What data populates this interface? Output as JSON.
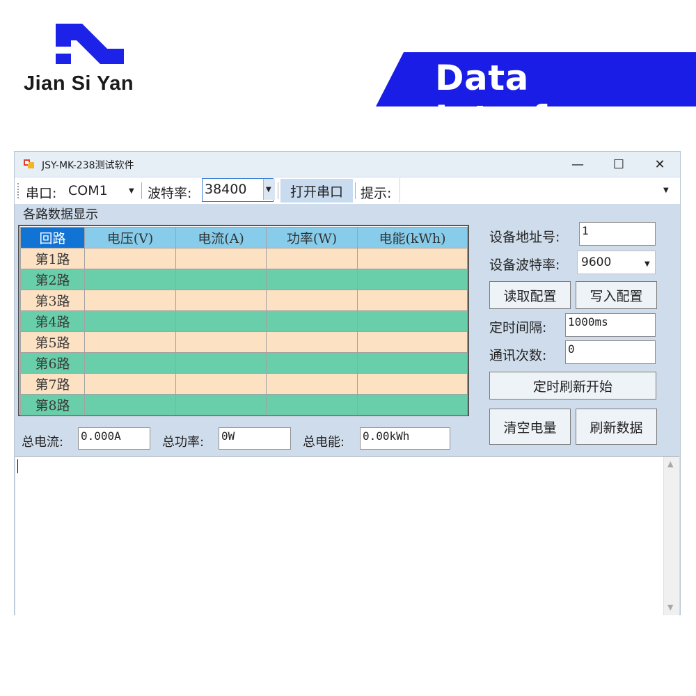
{
  "brand": {
    "name": "Jian Si Yan",
    "banner": "Data Interface",
    "colors": {
      "blue": "#1d22e8",
      "banner_blue": "#1a1de6"
    }
  },
  "window": {
    "title": "JSY-MK-238测试软件",
    "controls": {
      "minimize": "—",
      "maximize": "☐",
      "close": "✕"
    }
  },
  "toolbar": {
    "port_label": "串口:",
    "port_value": "COM1",
    "baud_label": "波特率:",
    "baud_value": "38400",
    "open_button": "打开串口",
    "tip_label": "提示:",
    "tip_value": ""
  },
  "grid": {
    "group_label": "各路数据显示",
    "headers": [
      "回路",
      "电压(V)",
      "电流(A)",
      "功率(W)",
      "电能(kWh)"
    ],
    "rows": [
      "第1路",
      "第2路",
      "第3路",
      "第4路",
      "第5路",
      "第6路",
      "第7路",
      "第8路"
    ],
    "colors": {
      "header": "#87cdeb",
      "header_selected": "#1173d3",
      "odd_row": "#fde1c3",
      "even_row": "#69ceaa"
    }
  },
  "totals": {
    "current_label": "总电流:",
    "current_value": "0.000A",
    "power_label": "总功率:",
    "power_value": "0W",
    "energy_label": "总电能:",
    "energy_value": "0.00kWh"
  },
  "device": {
    "address_label": "设备地址号:",
    "address_value": "1",
    "baud_label": "设备波特率:",
    "baud_value": "9600",
    "read_config": "读取配置",
    "write_config": "写入配置",
    "interval_label": "定时间隔:",
    "interval_value": "1000ms",
    "count_label": "通讯次数:",
    "count_value": "0",
    "start_timer": "定时刷新开始",
    "clear_energy": "清空电量",
    "refresh_data": "刷新数据"
  },
  "log": {
    "text": ""
  }
}
